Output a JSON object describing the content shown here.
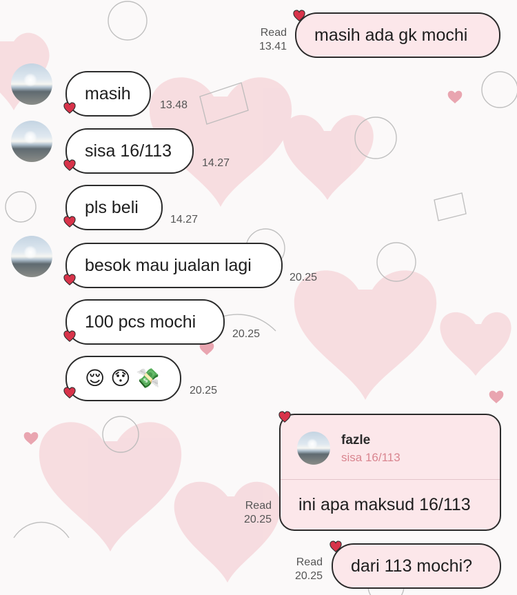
{
  "chat": {
    "messages": [
      {
        "dir": "out",
        "text": "masih ada gk mochi",
        "status": "Read",
        "time": "13.41"
      },
      {
        "dir": "in",
        "text": "masih",
        "time": "13.48",
        "avatar": true
      },
      {
        "dir": "in",
        "text": "sisa 16/113",
        "time": "14.27",
        "avatar": true
      },
      {
        "dir": "in",
        "text": "pls beli",
        "time": "14.27",
        "avatar": false
      },
      {
        "dir": "in",
        "text": "besok mau jualan lagi",
        "time": "20.25",
        "avatar": true
      },
      {
        "dir": "in",
        "text": "100 pcs mochi",
        "time": "20.25",
        "avatar": false
      },
      {
        "dir": "in",
        "emojis": [
          "😌",
          "😯",
          "💸"
        ],
        "time": "20.25",
        "avatar": false
      },
      {
        "dir": "out",
        "reply": {
          "name": "fazle",
          "quoted": "sisa 16/113"
        },
        "text": "ini apa maksud 16/113",
        "status": "Read",
        "time": "20.25"
      },
      {
        "dir": "out",
        "text": "dari 113 mochi?",
        "status": "Read",
        "time": "20.25"
      }
    ]
  },
  "colors": {
    "outgoing_bubble": "#fce7ea",
    "incoming_bubble": "#ffffff",
    "bubble_border": "#2b2b2b",
    "heart_accent": "#d8334a",
    "quoted_text": "#d9858f"
  },
  "icons": {
    "bubble_tail": "heart-icon",
    "background": "heart-pattern"
  }
}
